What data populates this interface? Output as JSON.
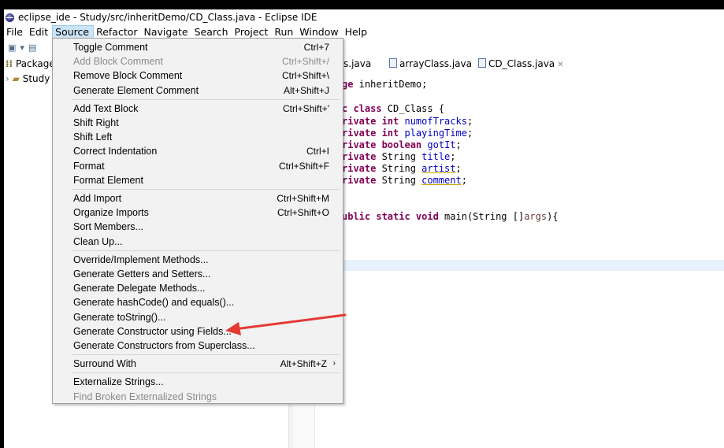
{
  "window": {
    "title": "eclipse_ide - Study/src/inheritDemo/CD_Class.java - Eclipse IDE"
  },
  "menubar": {
    "items": [
      "File",
      "Edit",
      "Source",
      "Refactor",
      "Navigate",
      "Search",
      "Project",
      "Run",
      "Window",
      "Help"
    ],
    "active": "Source"
  },
  "package_explorer": {
    "title": "Package",
    "project": "Study"
  },
  "editor": {
    "tabs": [
      "s.java",
      "arrayClass.java",
      "CD_Class.java"
    ],
    "active_tab": "CD_Class.java",
    "code_lines": [
      "ge inheritDemo;",
      "",
      "c class CD_Class {",
      "rivate int numofTracks;",
      "rivate int playingTime;",
      "rivate boolean gotIt;",
      "rivate String title;",
      "rivate String artist;",
      "rivate String comment;",
      "",
      "",
      "ublic static void main(String []args){"
    ]
  },
  "source_menu": {
    "groups": [
      [
        {
          "label": "Toggle Comment",
          "shortcut": "Ctrl+7",
          "enabled": true
        },
        {
          "label": "Add Block Comment",
          "shortcut": "Ctrl+Shift+/",
          "enabled": false
        },
        {
          "label": "Remove Block Comment",
          "shortcut": "Ctrl+Shift+\\",
          "enabled": true
        },
        {
          "label": "Generate Element Comment",
          "shortcut": "Alt+Shift+J",
          "enabled": true
        }
      ],
      [
        {
          "label": "Add Text Block",
          "shortcut": "Ctrl+Shift+'",
          "enabled": true
        },
        {
          "label": "Shift Right",
          "shortcut": "",
          "enabled": true
        },
        {
          "label": "Shift Left",
          "shortcut": "",
          "enabled": true
        },
        {
          "label": "Correct Indentation",
          "shortcut": "Ctrl+I",
          "enabled": true
        },
        {
          "label": "Format",
          "shortcut": "Ctrl+Shift+F",
          "enabled": true
        },
        {
          "label": "Format Element",
          "shortcut": "",
          "enabled": true
        }
      ],
      [
        {
          "label": "Add Import",
          "shortcut": "Ctrl+Shift+M",
          "enabled": true
        },
        {
          "label": "Organize Imports",
          "shortcut": "Ctrl+Shift+O",
          "enabled": true
        },
        {
          "label": "Sort Members...",
          "shortcut": "",
          "enabled": true
        },
        {
          "label": "Clean Up...",
          "shortcut": "",
          "enabled": true
        }
      ],
      [
        {
          "label": "Override/Implement Methods...",
          "shortcut": "",
          "enabled": true
        },
        {
          "label": "Generate Getters and Setters...",
          "shortcut": "",
          "enabled": true
        },
        {
          "label": "Generate Delegate Methods...",
          "shortcut": "",
          "enabled": true
        },
        {
          "label": "Generate hashCode() and equals()...",
          "shortcut": "",
          "enabled": true
        },
        {
          "label": "Generate toString()...",
          "shortcut": "",
          "enabled": true
        },
        {
          "label": "Generate Constructor using Fields...",
          "shortcut": "",
          "enabled": true
        },
        {
          "label": "Generate Constructors from Superclass...",
          "shortcut": "",
          "enabled": true
        }
      ],
      [
        {
          "label": "Surround With",
          "shortcut": "Alt+Shift+Z",
          "enabled": true,
          "submenu": true
        }
      ],
      [
        {
          "label": "Externalize Strings...",
          "shortcut": "",
          "enabled": true
        },
        {
          "label": "Find Broken Externalized Strings",
          "shortcut": "",
          "enabled": false
        }
      ]
    ]
  },
  "colors": {
    "annotation_arrow": "#e53935",
    "menu_background": "#f2f2f2",
    "keyword": "#7f0055",
    "field": "#0000c0"
  }
}
